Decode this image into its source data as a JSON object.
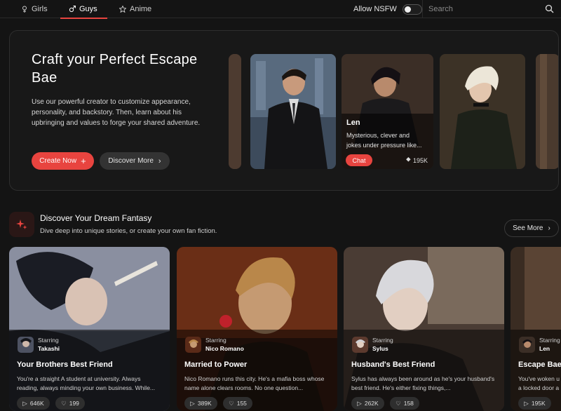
{
  "nav": {
    "tabs": [
      {
        "label": "Girls",
        "icon": "female-icon"
      },
      {
        "label": "Guys",
        "icon": "male-icon",
        "active": true
      },
      {
        "label": "Anime",
        "icon": "star-icon"
      }
    ],
    "nsfw_label": "Allow NSFW",
    "nsfw_enabled": false,
    "search_placeholder": "Search"
  },
  "hero": {
    "title": "Craft your Perfect Escape Bae",
    "description": "Use our powerful creator to customize appearance, personality, and backstory. Then, learn about his upbringing and values to forge your shared adventure.",
    "create_label": "Create Now",
    "discover_label": "Discover More",
    "featured": {
      "name": "Len",
      "description": "Mysterious, clever and jokes under pressure like...",
      "chat_label": "Chat",
      "count": "195K"
    }
  },
  "section": {
    "title": "Discover Your Dream Fantasy",
    "subtitle": "Dive deep into unique stories, or create your own fan fiction.",
    "see_more_label": "See More"
  },
  "stories": [
    {
      "starring_label": "Starring",
      "character": "Takashi",
      "title": "Your Brothers Best Friend",
      "description": "You're a straight A student at university. Always reading, always minding your own business. While...",
      "plays": "646K",
      "likes": "199"
    },
    {
      "starring_label": "Starring",
      "character": "Nico Romano",
      "title": "Married to Power",
      "description": "Nico Romano runs this city. He's a mafia boss whose name alone clears rooms. No one question...",
      "plays": "389K",
      "likes": "155"
    },
    {
      "starring_label": "Starring",
      "character": "Sylus",
      "title": "Husband's Best Friend",
      "description": "Sylus has always been around as he's your husband's best friend. He's either fixing things,...",
      "plays": "262K",
      "likes": "158"
    },
    {
      "starring_label": "Starring",
      "character": "Len",
      "title": "Escape Bae",
      "description": "You've woken u a locked door a",
      "plays": "195K",
      "likes": ""
    }
  ],
  "colors": {
    "accent": "#e8443f",
    "background": "#141414"
  }
}
